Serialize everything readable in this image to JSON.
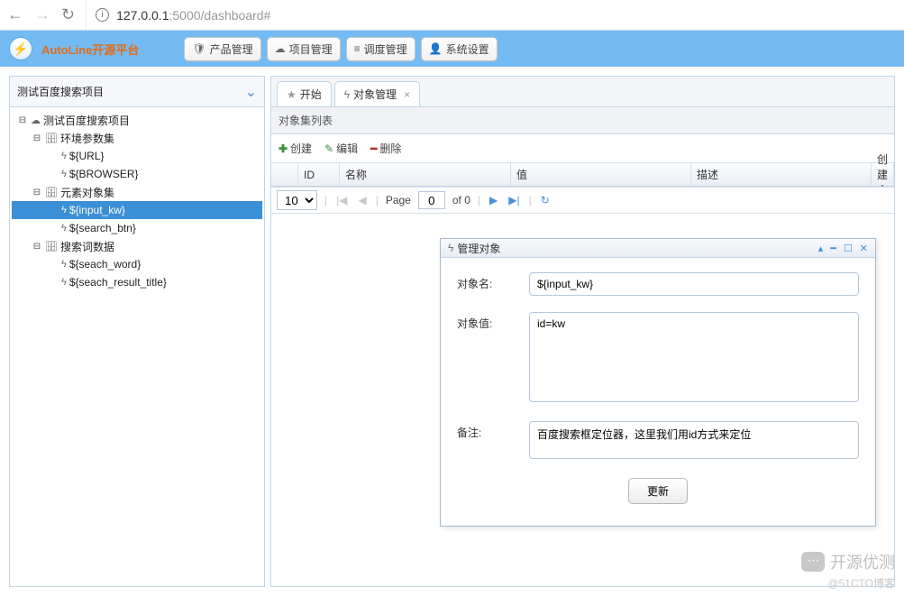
{
  "browser": {
    "url_black": "127.0.0.1",
    "url_grey": ":5000/dashboard#"
  },
  "header": {
    "brand": "AutoLine开源平台",
    "menus": [
      {
        "icon": "🛡",
        "label": "产品管理"
      },
      {
        "icon": "☁",
        "label": "项目管理"
      },
      {
        "icon": "≡",
        "label": "调度管理"
      },
      {
        "icon": "👤",
        "label": "系统设置"
      }
    ]
  },
  "left_panel": {
    "title": "测试百度搜索项目",
    "tree": {
      "root": {
        "label": "测试百度搜索项目"
      },
      "group1": {
        "label": "环境参数集"
      },
      "g1_items": [
        "${URL}",
        "${BROWSER}"
      ],
      "group2": {
        "label": "元素对象集"
      },
      "g2_items": [
        "${input_kw}",
        "${search_btn}"
      ],
      "group3": {
        "label": "搜索词数据"
      },
      "g3_items": [
        "${seach_word}",
        "${seach_result_title}"
      ]
    }
  },
  "tabs": {
    "items": [
      {
        "icon": "star",
        "label": "开始",
        "closable": false
      },
      {
        "icon": "bolt",
        "label": "对象管理",
        "closable": true
      }
    ]
  },
  "subheader": "对象集列表",
  "toolbar": {
    "create": "创建",
    "edit": "编辑",
    "delete": "删除"
  },
  "grid": {
    "cols": {
      "id": "ID",
      "name": "名称",
      "value": "值",
      "desc": "描述",
      "creator": "创建人"
    }
  },
  "pager": {
    "page_size": "10",
    "page_label": "Page",
    "page_current": "0",
    "of_label": "of 0"
  },
  "dialog": {
    "title": "管理对象",
    "fields": {
      "name_label": "对象名:",
      "name_value": "${input_kw}",
      "value_label": "对象值:",
      "value_value": "id=kw",
      "remark_label": "备注:",
      "remark_value": "百度搜索框定位器，这里我们用id方式来定位"
    },
    "button": "更新"
  },
  "watermark": {
    "line1": "开源优测",
    "line2": "@51CTO博客"
  }
}
